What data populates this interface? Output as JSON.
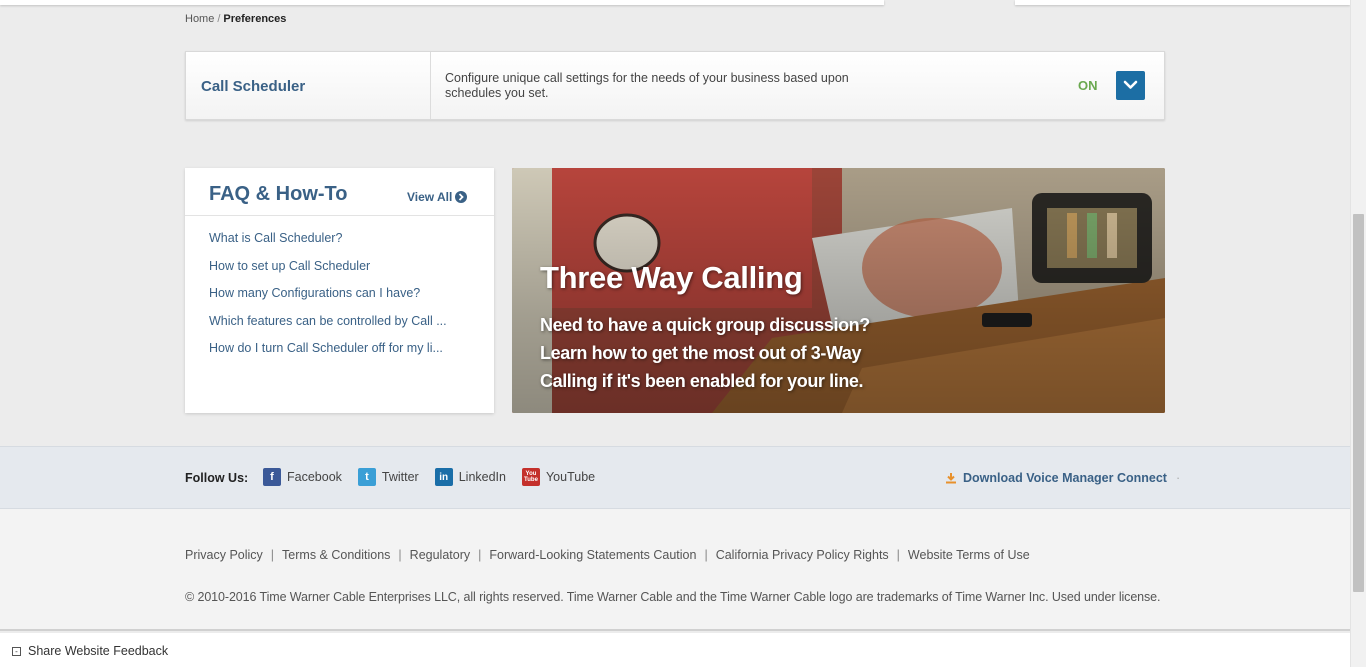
{
  "breadcrumb": {
    "home": "Home",
    "separator": "/",
    "current": "Preferences"
  },
  "scheduler": {
    "title": "Call Scheduler",
    "description": "Configure unique call settings for the needs of your business based upon schedules you set.",
    "status": "ON",
    "status_color": "#6aa84f",
    "toggle_icon": "chevron-down-icon"
  },
  "faq": {
    "title": "FAQ & How-To",
    "view_all": "View All",
    "items": [
      "What is Call Scheduler?",
      "How to set up Call Scheduler",
      "How many Configurations can I have?",
      "Which features can be controlled by Call ...",
      "How do I turn Call Scheduler off for my li..."
    ]
  },
  "promo": {
    "headline": "Three Way Calling",
    "body": "Need to have a quick group discussion? Learn how to get the most out of 3-Way Calling if it's been enabled for your line."
  },
  "social": {
    "follow_label": "Follow Us:",
    "links": [
      {
        "label": "Facebook",
        "icon": "facebook-icon",
        "glyph": "f",
        "color": "#3b5998"
      },
      {
        "label": "Twitter",
        "icon": "twitter-icon",
        "glyph": "t",
        "color": "#3a9fd6"
      },
      {
        "label": "LinkedIn",
        "icon": "linkedin-icon",
        "glyph": "in",
        "color": "#1a6ea8"
      },
      {
        "label": "YouTube",
        "icon": "youtube-icon",
        "glyph": "You Tube",
        "color": "#c4302b"
      }
    ],
    "download_label": "Download Voice Manager Connect",
    "download_icon": "download-icon"
  },
  "footer": {
    "links": [
      "Privacy Policy",
      "Terms & Conditions",
      "Regulatory",
      "Forward-Looking Statements Caution",
      "California Privacy Policy Rights",
      "Website Terms of Use"
    ],
    "copyright": "© 2010-2016 Time Warner Cable Enterprises LLC, all rights reserved. Time Warner Cable and the Time Warner Cable logo are trademarks of Time Warner Inc. Used under license."
  },
  "feedback": {
    "label": "Share Website Feedback",
    "icon_glyph": "-"
  },
  "colors": {
    "brand_blue": "#3a6186",
    "toggle_blue": "#1c6ea4",
    "download_orange": "#e8912c"
  }
}
